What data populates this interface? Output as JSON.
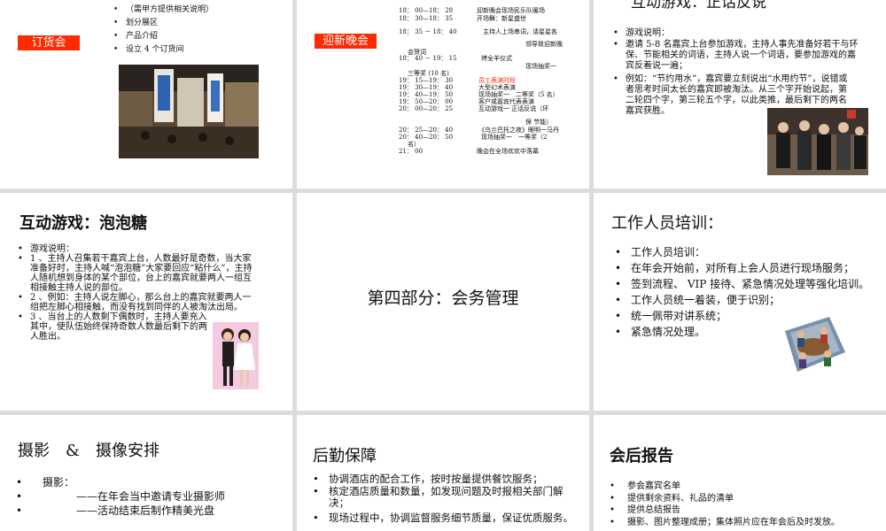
{
  "slide1": {
    "bullets": [
      "（需甲方提供相关说明）",
      "划分展区",
      "产品介绍",
      "设立 4 个订货间"
    ],
    "tag": "订货会",
    "photo_icon": "exhibition-hall-photo"
  },
  "slide2": {
    "tag": "迎新晚会",
    "rows": [
      {
        "time": "18： 00—18： 28",
        "text": "迎新晚会现场民乐队暖场"
      },
      {
        "time": "18： 30—18： 35",
        "text": "开场舞：新星盛世"
      },
      {
        "time": "18： 35 － 18： 40",
        "text": "主持人上场串词，请星星各"
      },
      {
        "time": "",
        "text": "领导致迎新晚"
      },
      {
        "time": "会贺词",
        "text": ""
      },
      {
        "time": "18： 40 － 19： 15",
        "text": "烤全羊仪式"
      },
      {
        "time": "",
        "text": "现场抽奖一"
      },
      {
        "time": "三等奖 (10 名)",
        "text": ""
      },
      {
        "time": "19： 15—19： 30",
        "text": "员工表演时段"
      },
      {
        "time": "19： 30—19： 40",
        "text": "大型幻术表演"
      },
      {
        "time": "19： 40—19： 50",
        "text": "现场抽奖一　二等奖（5 名）"
      },
      {
        "time": "19： 50—20： 00",
        "text": "客户或嘉宾代表表演"
      },
      {
        "time": "20： 00—20： 25",
        "text": "互动游戏一 正话反说（环"
      },
      {
        "time": "",
        "text": "保 节能）"
      },
      {
        "time": "20： 25—20： 40",
        "text": "《乌兰巴托之夜》眼明一马丹"
      },
      {
        "time": "20： 40—20： 50",
        "text": "现场抽奖一　一等奖（2"
      },
      {
        "time": "名）",
        "text": ""
      },
      {
        "time": "21： 00",
        "text": "晚会在全场欢欢中落幕"
      }
    ],
    "highlight_color": "#ff2a00"
  },
  "slide3": {
    "title": "互动游戏：正话反说",
    "bullets": [
      "游戏说明：",
      "邀请 5-8 名嘉宾上台参加游戏，主持人事先准备好若干与环保、节能相关的词语，主持人说一个词语，要参加游戏的嘉宾反着说一遍；",
      "例如：“节约用水”，嘉宾要立刻说出“水用约节”，说错或者思考时间太长的嘉宾即被淘汰。从三个字开始说起，第二轮四个字，第三轮五个字，以此类推，最后剩下的两名嘉宾获胜。"
    ]
  },
  "slide4": {
    "title": "互动游戏：泡泡糖",
    "bullets": [
      "游戏说明：",
      "1 、主持人召集若干嘉宾上台，人数最好是奇数，当大家准备好时，主持人喊“泡泡糖”大家要回应“粘什么”，主持人随机想到身体的某个部位，台上的嘉宾就要两人一组互相接触主持人说的部位。",
      "2 、例如：主持人说左脚心，那么台上的嘉宾就要两人一组把左脚心相接触，而没有找到同伴的人被淘汰出局。",
      "3 、当台上的人数剩下偶数时，主持人要充入其中，使队伍始终保持奇数人数最后剩下的两人胜出。"
    ]
  },
  "slide5": {
    "title": "第四部分：会务管理"
  },
  "slide6": {
    "title": "工作人员培训：",
    "bullets": [
      "工作人员培训：",
      "在年会开始前，对所有上会人员进行现场服务；",
      "签到流程、 VIP 接待、紧急情况处理等强化培训。",
      "工作人员统一着装，便于识别；",
      "统一佩带对讲系统；",
      "紧急情况处理。"
    ]
  },
  "slide7": {
    "title": "摄影　&　摄像安排",
    "bullets": [
      "摄影：",
      "——在年会当中邀请专业摄影师",
      "——活动结束后制作精美光盘"
    ]
  },
  "slide8": {
    "title": "后勤保障",
    "bullets": [
      "协调酒店的配合工作，按时按量提供餐饮服务；",
      "核定酒店质量和数量，如发现问题及时报相关部门解决；",
      "现场过程中，协调监督服务细节质量，保证优质服务。"
    ]
  },
  "slide9": {
    "title": "会后报告",
    "bullets": [
      "参会嘉宾名单",
      "提供剩余资料、礼品的清单",
      "提供总结报告",
      "摄影、图片整理成册；集体照片应在年会后及时发放。"
    ]
  }
}
